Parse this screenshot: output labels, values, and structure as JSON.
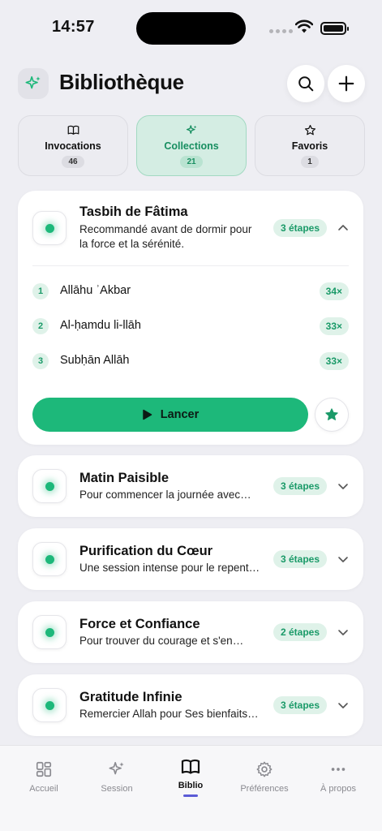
{
  "status": {
    "time": "14:57"
  },
  "header": {
    "title": "Bibliothèque",
    "logo_icon": "sparkles-icon",
    "search_icon": "search-icon",
    "add_icon": "plus-icon"
  },
  "tabs": [
    {
      "label": "Invocations",
      "count": "46",
      "icon": "book-icon",
      "active": false
    },
    {
      "label": "Collections",
      "count": "21",
      "icon": "sparkles-icon",
      "active": true
    },
    {
      "label": "Favoris",
      "count": "1",
      "icon": "star-icon",
      "active": false
    }
  ],
  "collections": [
    {
      "name": "Tasbih de Fâtima",
      "description": "Recommandé avant de dormir pour la force et la sérénité.",
      "badge": "3 étapes",
      "expanded": true,
      "steps": [
        {
          "num": "1",
          "text": "Allāhu ʾAkbar",
          "reps": "34×"
        },
        {
          "num": "2",
          "text": "Al-ḥamdu li-llāh",
          "reps": "33×"
        },
        {
          "num": "3",
          "text": "Subḥān Allāh",
          "reps": "33×"
        }
      ],
      "launch_label": "Lancer"
    },
    {
      "name": "Matin Paisible",
      "description": "Pour commencer la journée avec…",
      "badge": "3 étapes"
    },
    {
      "name": "Purification du Cœur",
      "description": "Une session intense pour le repent…",
      "badge": "3 étapes"
    },
    {
      "name": "Force et Confiance",
      "description": "Pour trouver du courage et s'en…",
      "badge": "2 étapes"
    },
    {
      "name": "Gratitude Infinie",
      "description": "Remercier Allah pour Ses bienfaits…",
      "badge": "3 étapes"
    }
  ],
  "tabbar": [
    {
      "label": "Accueil",
      "icon": "grid-icon"
    },
    {
      "label": "Session",
      "icon": "sparkles-icon"
    },
    {
      "label": "Biblio",
      "icon": "book-icon",
      "active": true
    },
    {
      "label": "Préférences",
      "icon": "gear-icon"
    },
    {
      "label": "À propos",
      "icon": "more-icon"
    }
  ],
  "colors": {
    "accent": "#1db87a",
    "background": "#eeeef3",
    "nav_indicator": "#5b5bd6"
  }
}
